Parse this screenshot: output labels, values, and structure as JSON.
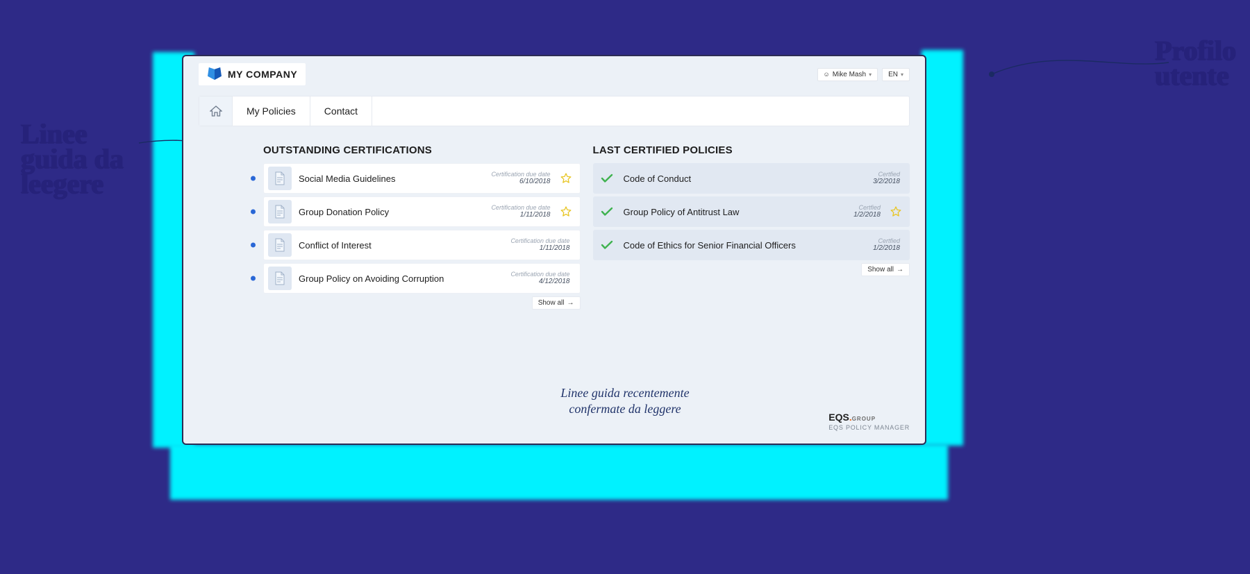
{
  "header": {
    "company_name": "MY COMPANY",
    "user_name": "Mike Mash",
    "language": "EN"
  },
  "nav": {
    "home": "Home",
    "policies": "My Policies",
    "contact": "Contact"
  },
  "outstanding": {
    "title": "OUTSTANDING CERTIFICATIONS",
    "due_label": "Certification due date",
    "items": [
      {
        "title": "Social Media Guidelines",
        "date": "6/10/2018",
        "star": true
      },
      {
        "title": "Group Donation Policy",
        "date": "1/11/2018",
        "star": true
      },
      {
        "title": "Conflict of Interest",
        "date": "1/11/2018",
        "star": false
      },
      {
        "title": "Group Policy on Avoiding Corruption",
        "date": "4/12/2018",
        "star": false
      }
    ],
    "show_all": "Show all"
  },
  "certified": {
    "title": "LAST CERTIFIED POLICIES",
    "label": "Certfied",
    "items": [
      {
        "title": "Code of Conduct",
        "date": "3/2/2018",
        "star": false
      },
      {
        "title": "Group Policy of Antitrust Law",
        "date": "1/2/2018",
        "star": true
      },
      {
        "title": "Code of Ethics for Senior Financial Officers",
        "date": "1/2/2018",
        "star": false
      }
    ],
    "show_all": "Show all"
  },
  "footer": {
    "brand": "EQS",
    "brand_suffix": "GROUP",
    "product": "EQS POLICY MANAGER"
  },
  "annotations": {
    "top_left": "Linee\nguida da\nleegere",
    "top_right": "Profilo\nutente",
    "bottom": "Linee guida recentemente confermate da leggere"
  }
}
